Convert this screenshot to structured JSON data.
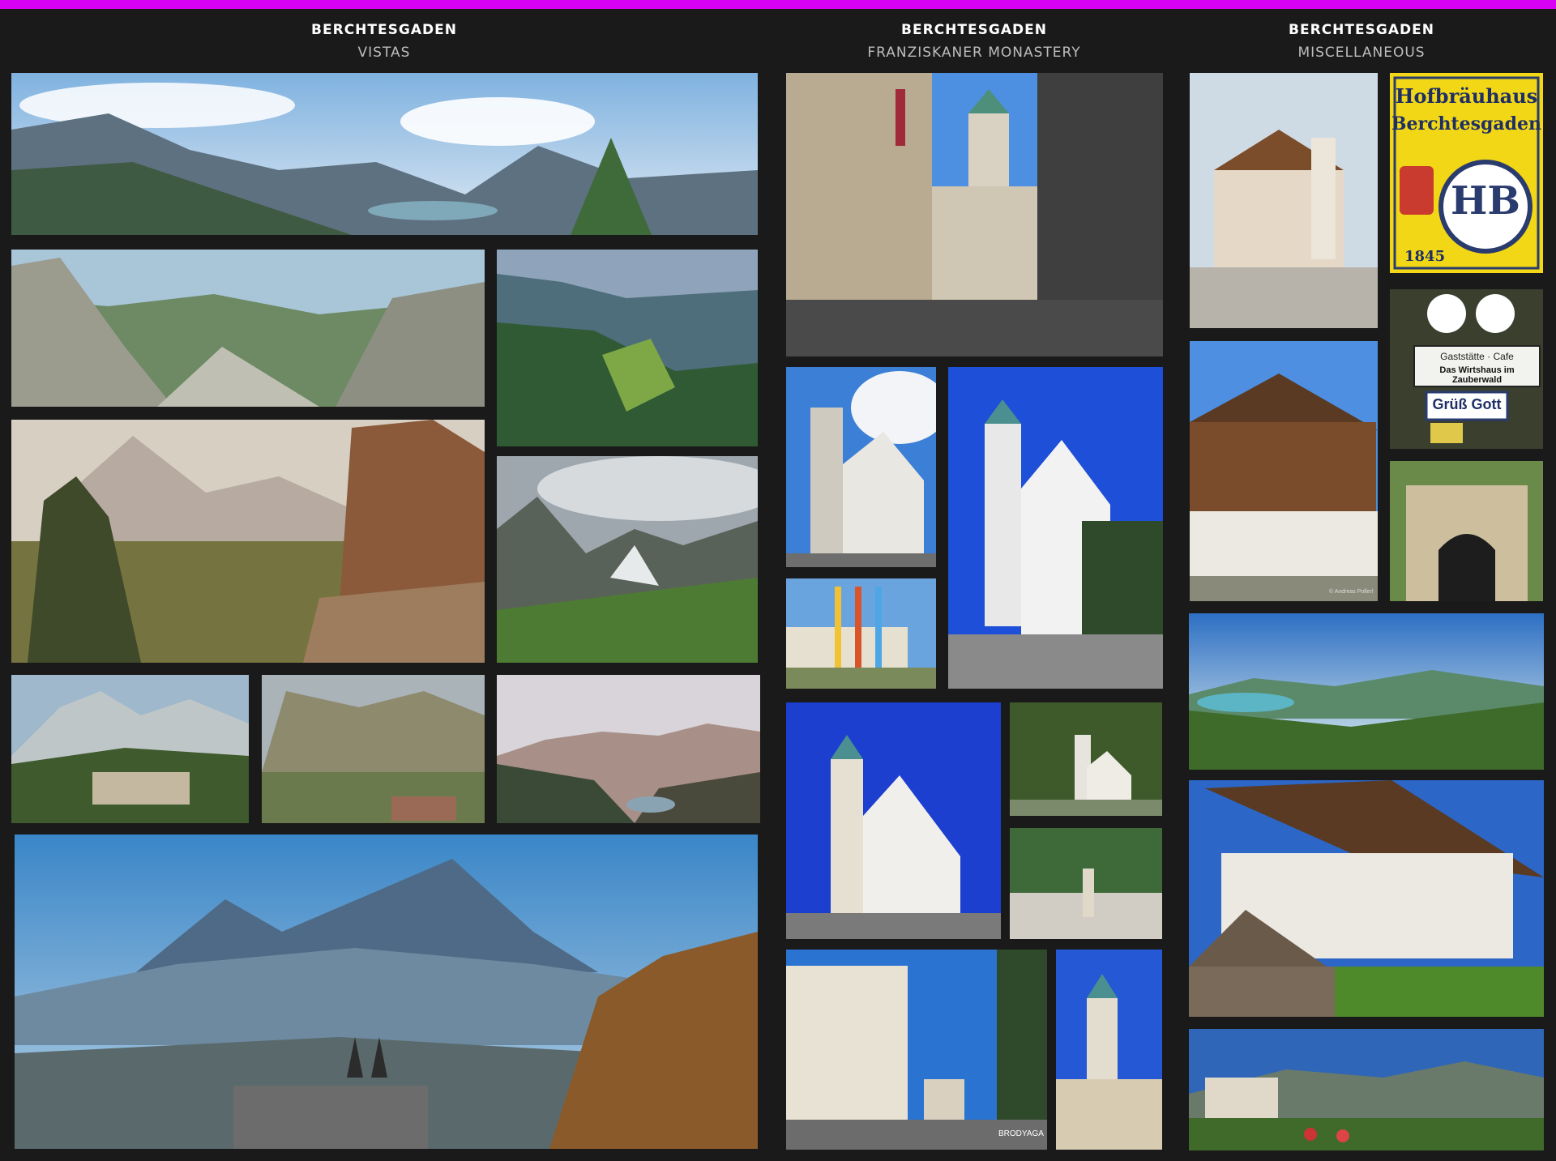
{
  "header_bar_color": "#d800f5",
  "columns": [
    {
      "title": "BERCHTESGADEN",
      "subtitle": "VISTAS"
    },
    {
      "title": "BERCHTESGADEN",
      "subtitle": "FRANZISKANER MONASTERY"
    },
    {
      "title": "BERCHTESGADEN",
      "subtitle": "MISCELLANEOUS"
    }
  ],
  "signs": {
    "hofbrauhaus_line1": "Hofbräuhaus",
    "hofbrauhaus_line2": "Berchtesgaden",
    "hofbrauhaus_mono": "HB",
    "hofbrauhaus_year": "1845",
    "cafe_line1": "Gaststätte · Cafe",
    "cafe_line2": "Das Wirtshaus im Zauberwald",
    "gruss_gott": "Grüß Gott"
  },
  "watermarks": {
    "brodyaga": "BRODYAGA",
    "andreas": "© Andreas Pollerl"
  }
}
